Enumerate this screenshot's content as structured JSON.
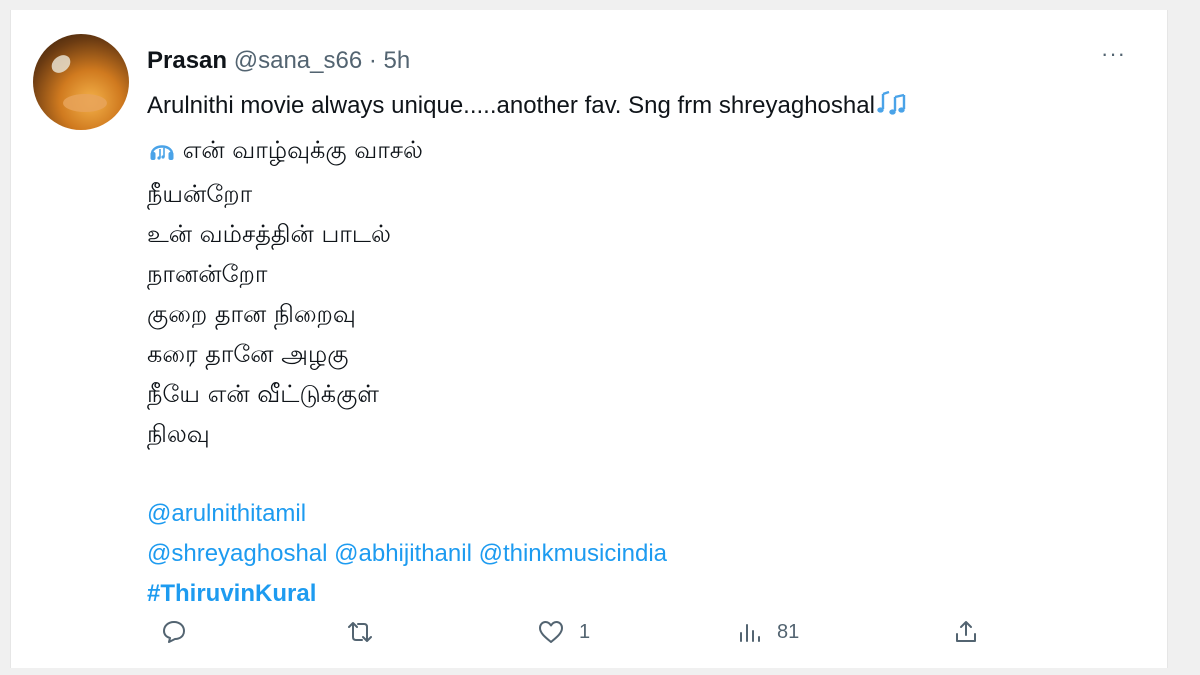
{
  "tweet": {
    "author_name": "Prasan",
    "author_handle": "@sana_s66",
    "separator": "·",
    "time": "5h",
    "more_label": "···",
    "lines": [
      "Arulnithi movie always unique.....another fav. Sng frm shreyaghoshal",
      "என் வாழ்வுக்கு வாசல்",
      "நீயன்றோ",
      "உன் வம்சத்தின் பாடல்",
      "நானன்றோ",
      "குறை தான நிறைவு",
      "கரை தானே அழகு",
      "நீயே என் வீட்டுக்குள்",
      "நிலவு"
    ],
    "mentions_line1": "@arulnithitamil",
    "mentions_line2": "@shreyaghoshal @abhijithanil @thinkmusicindia",
    "hashtag": "#ThiruvinKural",
    "accent_color": "#1d9bf0"
  },
  "actions": {
    "reply_count": "",
    "retweet_count": "",
    "like_count": "1",
    "views_count": "81"
  },
  "icons": [
    "reply-icon",
    "retweet-icon",
    "like-icon",
    "views-icon",
    "share-icon",
    "music-notes-icon",
    "headphones-icon"
  ]
}
